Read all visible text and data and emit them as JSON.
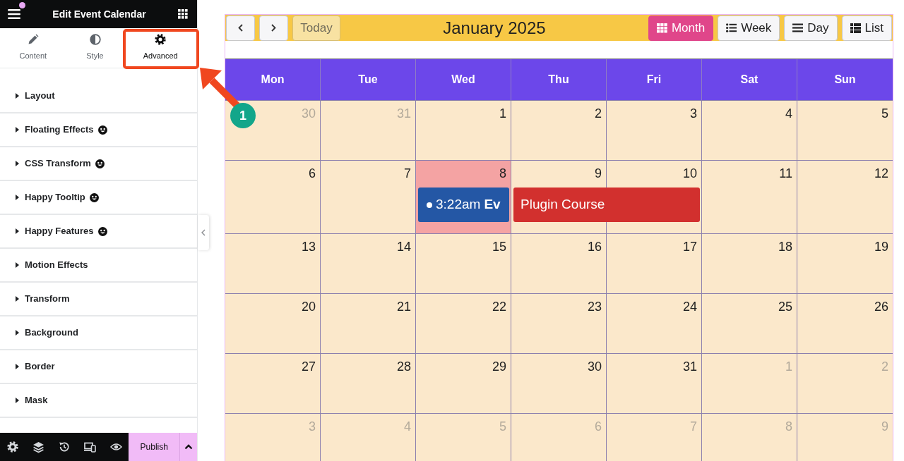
{
  "editor_panel": {
    "title": "Edit Event Calendar",
    "notification": true,
    "tabs": [
      {
        "label": "Content",
        "selected": false
      },
      {
        "label": "Style",
        "selected": false
      },
      {
        "label": "Advanced",
        "selected": true
      }
    ],
    "sections": [
      {
        "label": "Layout",
        "addon_badge": false
      },
      {
        "label": "Floating Effects",
        "addon_badge": true
      },
      {
        "label": "CSS Transform",
        "addon_badge": true
      },
      {
        "label": "Happy Tooltip",
        "addon_badge": true
      },
      {
        "label": "Happy Features",
        "addon_badge": true
      },
      {
        "label": "Motion Effects",
        "addon_badge": false
      },
      {
        "label": "Transform",
        "addon_badge": false
      },
      {
        "label": "Background",
        "addon_badge": false
      },
      {
        "label": "Border",
        "addon_badge": false
      },
      {
        "label": "Mask",
        "addon_badge": false
      }
    ],
    "footer": {
      "publish": "Publish"
    }
  },
  "calendar": {
    "today_button": {
      "label": "Today",
      "disabled": true
    },
    "title": "January 2025",
    "views": [
      {
        "label": "Month",
        "selected": true
      },
      {
        "label": "Week",
        "selected": false
      },
      {
        "label": "Day",
        "selected": false
      },
      {
        "label": "List",
        "selected": false
      }
    ],
    "weekdays": [
      "Mon",
      "Tue",
      "Wed",
      "Thu",
      "Fri",
      "Sat",
      "Sun"
    ],
    "weeks": [
      {
        "days": [
          {
            "day": "30",
            "other_month": true,
            "today": false
          },
          {
            "day": "31",
            "other_month": true,
            "today": false
          },
          {
            "day": "1",
            "other_month": false,
            "today": false
          },
          {
            "day": "2",
            "other_month": false,
            "today": false
          },
          {
            "day": "3",
            "other_month": false,
            "today": false
          },
          {
            "day": "4",
            "other_month": false,
            "today": false
          },
          {
            "day": "5",
            "other_month": false,
            "today": false
          }
        ]
      },
      {
        "days": [
          {
            "day": "6",
            "other_month": false,
            "today": false
          },
          {
            "day": "7",
            "other_month": false,
            "today": false
          },
          {
            "day": "8",
            "other_month": false,
            "today": true,
            "events": [
              {
                "kind": "timed",
                "time": "3:22am",
                "title": "Ev",
                "color": "#2457a5",
                "continues_next_day": false
              }
            ]
          },
          {
            "day": "9",
            "other_month": false,
            "today": false,
            "events": [
              {
                "kind": "allday",
                "title": "Plugin Course",
                "color": "#d2302e",
                "continues_next_day": true
              }
            ]
          },
          {
            "day": "10",
            "other_month": false,
            "today": false
          },
          {
            "day": "11",
            "other_month": false,
            "today": false
          },
          {
            "day": "12",
            "other_month": false,
            "today": false
          }
        ]
      },
      {
        "days": [
          {
            "day": "13",
            "other_month": false,
            "today": false
          },
          {
            "day": "14",
            "other_month": false,
            "today": false
          },
          {
            "day": "15",
            "other_month": false,
            "today": false
          },
          {
            "day": "16",
            "other_month": false,
            "today": false
          },
          {
            "day": "17",
            "other_month": false,
            "today": false
          },
          {
            "day": "18",
            "other_month": false,
            "today": false
          },
          {
            "day": "19",
            "other_month": false,
            "today": false
          }
        ]
      },
      {
        "days": [
          {
            "day": "20",
            "other_month": false,
            "today": false
          },
          {
            "day": "21",
            "other_month": false,
            "today": false
          },
          {
            "day": "22",
            "other_month": false,
            "today": false
          },
          {
            "day": "23",
            "other_month": false,
            "today": false
          },
          {
            "day": "24",
            "other_month": false,
            "today": false
          },
          {
            "day": "25",
            "other_month": false,
            "today": false
          },
          {
            "day": "26",
            "other_month": false,
            "today": false
          }
        ]
      },
      {
        "days": [
          {
            "day": "27",
            "other_month": false,
            "today": false
          },
          {
            "day": "28",
            "other_month": false,
            "today": false
          },
          {
            "day": "29",
            "other_month": false,
            "today": false
          },
          {
            "day": "30",
            "other_month": false,
            "today": false
          },
          {
            "day": "31",
            "other_month": false,
            "today": false
          },
          {
            "day": "1",
            "other_month": true,
            "today": false
          },
          {
            "day": "2",
            "other_month": true,
            "today": false
          }
        ]
      },
      {
        "days": [
          {
            "day": "3",
            "other_month": true,
            "today": false
          },
          {
            "day": "4",
            "other_month": true,
            "today": false
          },
          {
            "day": "5",
            "other_month": true,
            "today": false
          },
          {
            "day": "6",
            "other_month": true,
            "today": false
          },
          {
            "day": "7",
            "other_month": true,
            "today": false
          },
          {
            "day": "8",
            "other_month": true,
            "today": false
          },
          {
            "day": "9",
            "other_month": true,
            "today": false
          }
        ]
      }
    ]
  },
  "annotation": {
    "step": "1"
  }
}
